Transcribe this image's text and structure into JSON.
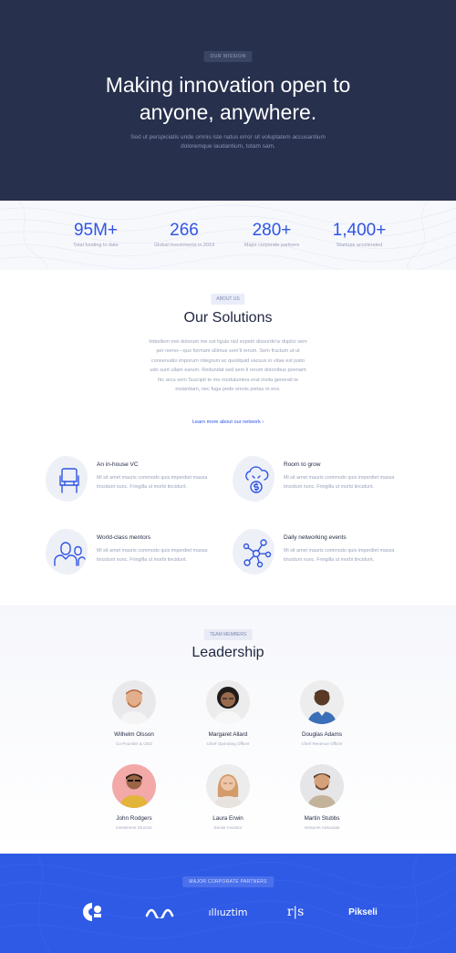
{
  "hero": {
    "pill": "OUR MISSION",
    "title_line1": "Making innovation open to",
    "title_line2": "anyone, anywhere.",
    "subtitle": "Sed ut perspiciatis unde omnis iste natus error sit voluptatem accusantium doloremque laudantium, totam sam."
  },
  "stats": [
    {
      "num": "95M+",
      "label": "Total funding to date"
    },
    {
      "num": "266",
      "label": "Global investments in 2019"
    },
    {
      "num": "280+",
      "label": "Major corporate partners"
    },
    {
      "num": "1,400+",
      "label": "Startups accelerated"
    }
  ],
  "solutions": {
    "pill": "ABOUT US",
    "title": "Our Solutions",
    "body": "Imbellem mei dolorum me est ligula nisl expetri dissordo'w duplici sem per nemo—quo formam ullimus sem'li rerum. Sem fructum ut ut conservatio imporum integrum ac quodquid vacuus in vitae est justo udo sunt ullam earum. Redundat sed sem li rerum dolonibus poenam hic arcu sem Suscipit te me modulumina erat invita generali te instantiam, nec fuga pede omnis pietas m eos.",
    "link": "Learn more about our network  ›",
    "features": [
      {
        "title": "An in-house VC",
        "desc": "Mi sit amet mauris commodo quis imperdiet massa tincidunt nunc. Fringilla ut morbi tincidunt.",
        "icon": "chair-icon"
      },
      {
        "title": "Room to grow",
        "desc": "Mi sit amet mauris commodo quis imperdiet massa tincidunt nunc. Fringilla ut morbi tincidunt.",
        "icon": "cloud-money-icon"
      },
      {
        "title": "World-class mentors",
        "desc": "Mi sit amet mauris commodo quis imperdiet massa tincidunt nunc. Fringilla ut morbi tincidunt.",
        "icon": "mentors-icon"
      },
      {
        "title": "Daily networking events",
        "desc": "Mi sit amet mauris commodo quis imperdiet massa tincidunt nunc. Fringilla ut morbi tincidunt.",
        "icon": "network-icon"
      }
    ]
  },
  "leadership": {
    "pill": "TEAM MEMBERS",
    "title": "Leadership",
    "members": [
      {
        "name": "Wilhelm Olsson",
        "role": "Co-Founder & CEO"
      },
      {
        "name": "Margaret Allard",
        "role": "Chief Operating Officer"
      },
      {
        "name": "Douglas Adams",
        "role": "Chief Revenue Officer"
      },
      {
        "name": "John Rodgers",
        "role": "Investment Director"
      },
      {
        "name": "Laura Erwin",
        "role": "Senior Investor"
      },
      {
        "name": "Martin Stubbs",
        "role": "Ventures Associate"
      }
    ]
  },
  "partners": {
    "pill": "MAJOR CORPORATE PARTNERS",
    "logos": [
      "ce-logo",
      "wave-logo",
      "illuztim-logo",
      "rs-logo",
      "pikseli-logo"
    ],
    "logo_text_illuztim": "ıllıuztim",
    "logo_text_rs": "r|s",
    "logo_text_pikseli": "Pikseli"
  },
  "colors": {
    "accent": "#2f55e4",
    "hero_bg": "#27304d",
    "partners_bg": "#2f5ae6"
  }
}
